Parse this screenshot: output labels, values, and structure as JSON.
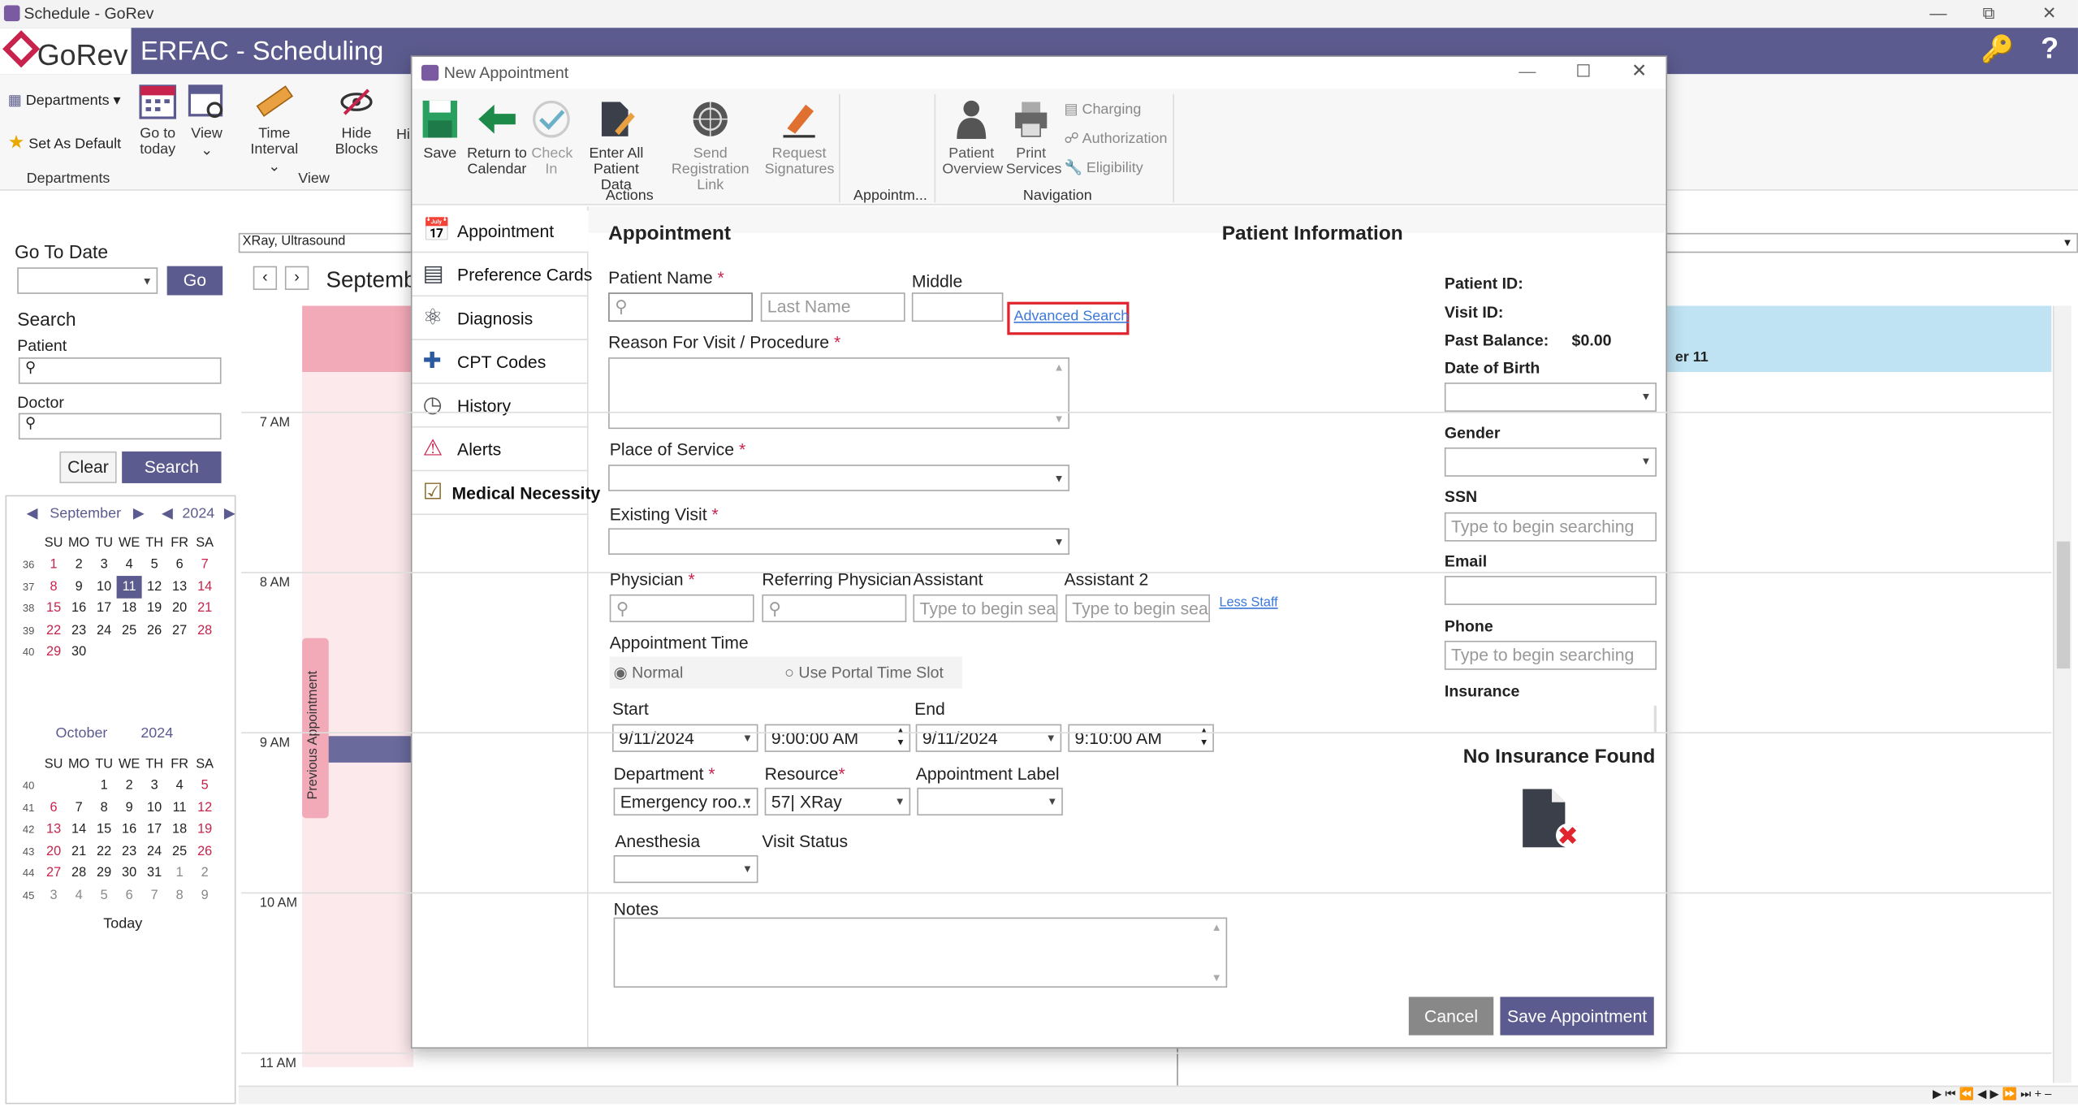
{
  "window": {
    "title": "Schedule - GoRev"
  },
  "app": {
    "logo": "GoRev",
    "title": "ERFAC - Scheduling"
  },
  "ribbon": {
    "departments_label": "Departments",
    "set_default": "Set As Default",
    "group_departments": "Departments",
    "go_to_today": [
      "Go to",
      "today"
    ],
    "view": "View",
    "time_interval": "Time Interval",
    "hide_blocks": "Hide Blocks",
    "hi": "Hi",
    "group_view": "View"
  },
  "left": {
    "go_to_date": "Go To Date",
    "go": "Go",
    "search_title": "Search",
    "patient": "Patient",
    "doctor": "Doctor",
    "clear": "Clear",
    "search": "Search",
    "today": "Today",
    "cal1": {
      "month": "September",
      "year": "2024",
      "weeks": [
        "36",
        "37",
        "38",
        "39",
        "40"
      ],
      "rows": [
        [
          "",
          "",
          "",
          "",
          "",
          "",
          ""
        ],
        [
          "",
          "",
          "",
          "",
          "",
          "",
          ""
        ],
        [
          "",
          "",
          "",
          "",
          "",
          "",
          ""
        ],
        [
          "",
          "",
          "",
          "",
          "",
          "",
          ""
        ],
        [
          "",
          "",
          "",
          "",
          "",
          "",
          ""
        ]
      ]
    },
    "cal_days": [
      "SU",
      "MO",
      "TU",
      "WE",
      "TH",
      "FR",
      "SA"
    ],
    "cal2": {
      "month": "October",
      "year": "2024",
      "weeks": [
        "40",
        "41",
        "42",
        "43",
        "44",
        "45"
      ]
    }
  },
  "schedule": {
    "filter": "XRay, Ultrasound",
    "month": "Septemb",
    "times": [
      "7 AM",
      "8 AM",
      "9 AM",
      "10 AM",
      "11 AM"
    ],
    "day_header": "er 11",
    "prev_appt": "Previous Appointment"
  },
  "dialog": {
    "title": "New Appointment",
    "toolbar": {
      "save": "Save",
      "return": [
        "Return to",
        "Calendar"
      ],
      "check_in": [
        "Check",
        "In"
      ],
      "enter_all": [
        "Enter All",
        "Patient Data"
      ],
      "send_reg": [
        "Send Registration",
        "Link"
      ],
      "request_sig": [
        "Request",
        "Signatures"
      ],
      "group_actions": "Actions",
      "group_appt": "Appointm...",
      "patient_overview": [
        "Patient",
        "Overview"
      ],
      "print_services": [
        "Print",
        "Services"
      ],
      "charging": "Charging",
      "authorization": "Authorization",
      "eligibility": "Eligibility",
      "group_nav": "Navigation"
    },
    "nav": [
      "Appointment",
      "Preference Cards",
      "Diagnosis",
      "CPT Codes",
      "History",
      "Alerts",
      "Medical Necessity"
    ],
    "form": {
      "heading": "Appointment",
      "patient_name": "Patient Name",
      "last_name_ph": "Last Name",
      "middle": "Middle",
      "advanced_search": "Advanced Search",
      "reason": "Reason For Visit / Procedure",
      "place": "Place of Service",
      "existing": "Existing Visit",
      "physician": "Physician",
      "referring": "Referring Physician",
      "assistant": "Assistant",
      "assistant2": "Assistant 2",
      "search_ph": "Type to begin searc",
      "less_staff": "Less Staff",
      "appt_time": "Appointment Time",
      "normal": "Normal",
      "portal": "Use Portal Time Slot",
      "start": "Start",
      "end": "End",
      "start_date": "9/11/2024",
      "start_time": "9:00:00 AM",
      "end_date": "9/11/2024",
      "end_time": "9:10:00 AM",
      "department": "Department",
      "resource": "Resource",
      "appt_label": "Appointment Label",
      "dept_val": "Emergency roo...",
      "res_val": "57| XRay",
      "anesthesia": "Anesthesia",
      "visit_status": "Visit Status",
      "notes": "Notes"
    },
    "patient_info": {
      "heading": "Patient Information",
      "patient_id": "Patient ID:",
      "visit_id": "Visit ID:",
      "past_balance": "Past Balance:",
      "balance_val": "$0.00",
      "dob": "Date of Birth",
      "gender": "Gender",
      "ssn": "SSN",
      "email": "Email",
      "phone": "Phone",
      "insurance": "Insurance",
      "search_ph": "Type to begin searching",
      "no_ins": "No Insurance Found"
    },
    "cancel": "Cancel",
    "save_appt": "Save Appointment"
  },
  "colors": {
    "brand": "#5c5b8f",
    "accent": "#c8234c",
    "highlight": "#e0252e"
  }
}
